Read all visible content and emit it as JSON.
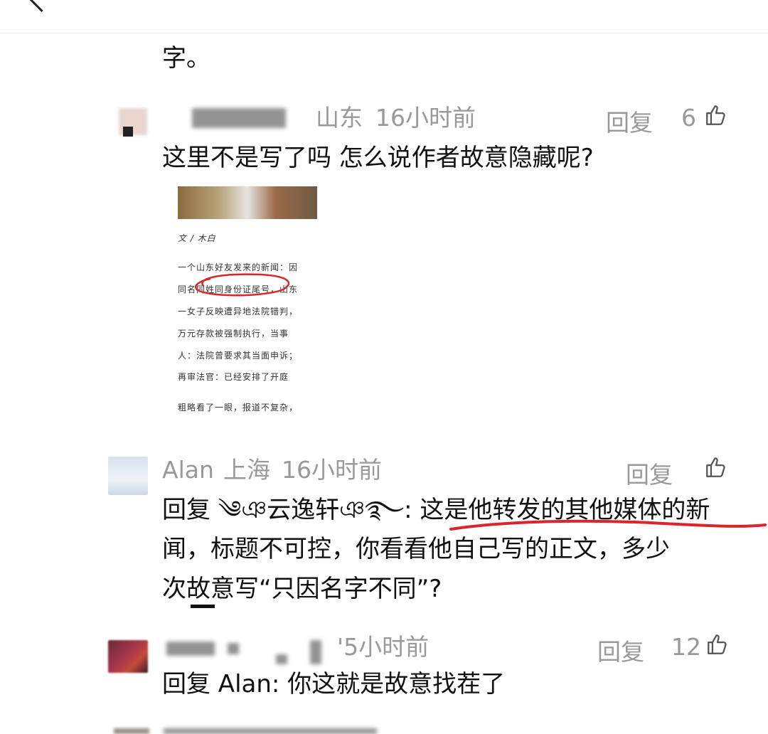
{
  "top_fragment": "字。",
  "comments": [
    {
      "location": "山东",
      "time": "16小时前",
      "reply_label": "回复",
      "likes": "6",
      "text": "这里不是写了吗  怎么说作者故意隐藏呢?",
      "quoted": {
        "byline": "文 / 木白",
        "lines": [
          "一个山东好友发来的新闻：因",
          "同名同姓同身份证尾号，山东",
          "一女子反映遭异地法院错判，",
          "万元存款被强制执行，当事",
          "人：法院曾要求其当面申诉；",
          "再审法官：已经安排了开庭",
          "粗略看了一眼，报道不复杂，"
        ]
      }
    },
    {
      "name": "Alan",
      "location": "上海",
      "time": "16小时前",
      "reply_label": "回复",
      "likes": "",
      "text_line1": "回复 ༄ঞ云逸轩ঞ࿐: 这是他转发的其他媒体的新",
      "text_line2": "闻，标题不可控，你看看他自己写的正文，多少",
      "text_line3": "次故意写“只因名字不同”?"
    },
    {
      "time": "'5小时前",
      "reply_label": "回复",
      "likes": "12",
      "text": "回复 Alan: 你这就是故意找茬了"
    }
  ],
  "colors": {
    "meta": "#999999",
    "text": "#111111",
    "red_mark": "#d9262c"
  }
}
